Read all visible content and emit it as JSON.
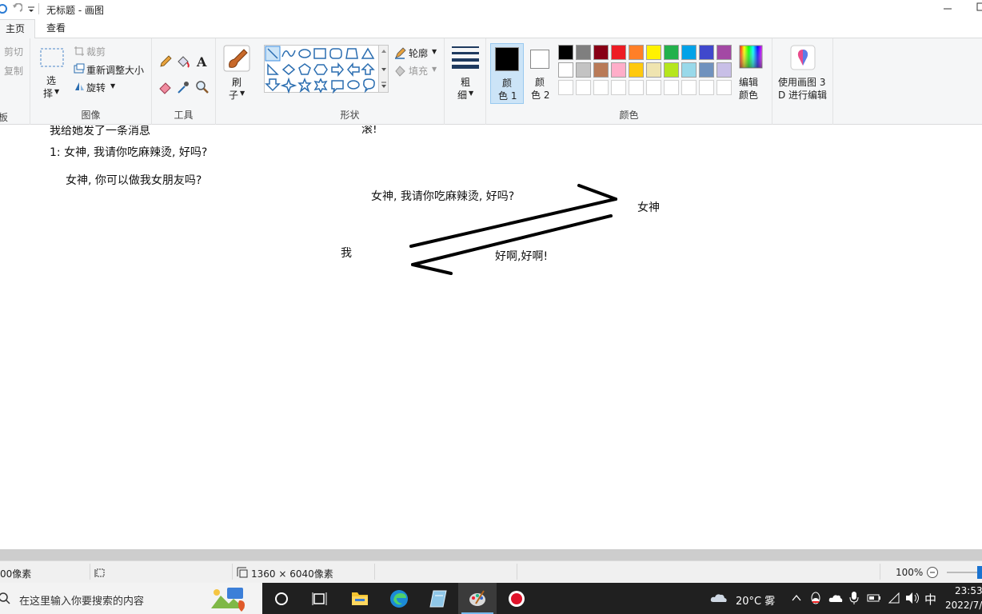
{
  "window": {
    "title": "无标题 - 画图"
  },
  "tabs": [
    {
      "label": "主页"
    },
    {
      "label": "查看"
    }
  ],
  "ribbon": {
    "clipboard": {
      "cut": "剪切",
      "copy": "复制",
      "group_label": "板"
    },
    "image": {
      "select": "选\n择",
      "select_line1": "选",
      "select_line2": "择",
      "crop": "裁剪",
      "resize": "重新调整大小",
      "rotate": "旋转",
      "group_label": "图像"
    },
    "tools": {
      "group_label": "工具"
    },
    "brushes": {
      "line1": "刷",
      "line2": "子"
    },
    "shapes": {
      "outline": "轮廓",
      "fill": "填充",
      "group_label": "形状"
    },
    "size": {
      "line1": "粗",
      "line2": "细"
    },
    "colors": {
      "color1_line1": "颜",
      "color1_line2": "色 1",
      "color2_line1": "颜",
      "color2_line2": "色 2",
      "edit_line1": "编辑",
      "edit_line2": "颜色",
      "group_label": "颜色",
      "color1": "#000000",
      "color2": "#ffffff",
      "palette_row1": [
        "#000000",
        "#7f7f7f",
        "#880015",
        "#ed1c24",
        "#ff7f27",
        "#fff200",
        "#22b14c",
        "#00a2e8",
        "#3f48cc",
        "#a349a4"
      ],
      "palette_row2": [
        "#ffffff",
        "#c3c3c3",
        "#b97a57",
        "#ffaec9",
        "#ffc90e",
        "#efe4b0",
        "#b5e61d",
        "#99d9ea",
        "#7092be",
        "#c8bfe7"
      ]
    },
    "paint3d": {
      "line1": "使用画图 3",
      "line2": "D 进行编辑"
    }
  },
  "canvas": {
    "line_top_cut": "我给她发了一条消息",
    "line_top_right_cut": "滚!",
    "line1": "1: 女神, 我请你吃麻辣烫, 好吗?",
    "line2": "女神, 你可以做我女朋友吗?",
    "arrow_top_text": "女神, 我请你吃麻辣烫, 好吗?",
    "goddess": "女神",
    "me": "我",
    "reply": "好啊,好啊!"
  },
  "statusbar": {
    "pos_text": "00像素",
    "size_text": "1360 × 6040像素",
    "zoom": "100%"
  },
  "taskbar": {
    "search_placeholder": "在这里输入你要搜索的内容",
    "weather": "20°C 雾",
    "ime": "中",
    "time": "23:53",
    "date": "2022/7/"
  }
}
